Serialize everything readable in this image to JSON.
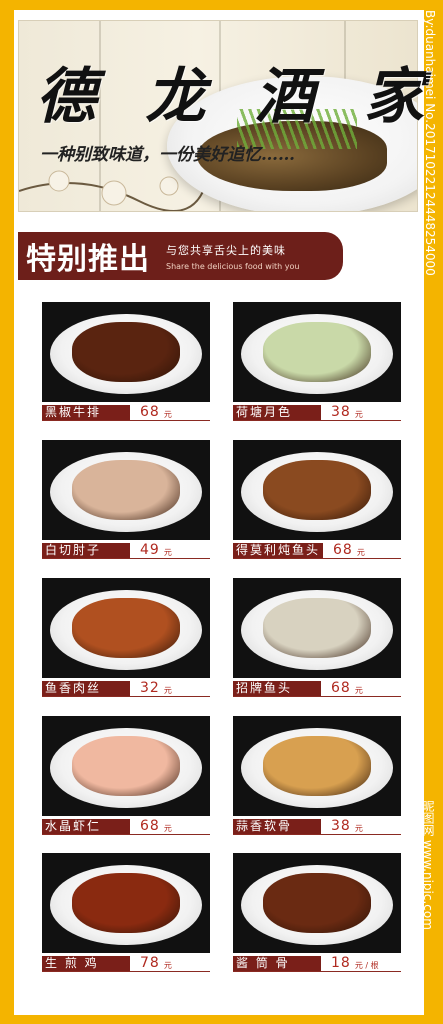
{
  "banner": {
    "title_chars": [
      "德",
      "龙",
      "酒",
      "家"
    ],
    "slogan": "一种别致味道，一份美好追忆……"
  },
  "section": {
    "title": "特别推出",
    "subtitle_cn": "与您共享舌尖上的美味",
    "subtitle_en": "Share the delicious food with you"
  },
  "dishes": [
    {
      "name": "黑椒牛排",
      "price": "68",
      "unit": "元",
      "food_color": "#5a2410"
    },
    {
      "name": "荷塘月色",
      "price": "38",
      "unit": "元",
      "food_color": "#c9d9a8"
    },
    {
      "name": "白切肘子",
      "price": "49",
      "unit": "元",
      "food_color": "#d9b49a"
    },
    {
      "name": "得莫利炖鱼头",
      "price": "68",
      "unit": "元",
      "food_color": "#8a4a20"
    },
    {
      "name": "鱼香肉丝",
      "price": "32",
      "unit": "元",
      "food_color": "#b05020"
    },
    {
      "name": "招牌鱼头",
      "price": "68",
      "unit": "元",
      "food_color": "#d8d2c0"
    },
    {
      "name": "水晶虾仁",
      "price": "68",
      "unit": "元",
      "food_color": "#f0b8a0"
    },
    {
      "name": "蒜香软骨",
      "price": "38",
      "unit": "元",
      "food_color": "#d8a050"
    },
    {
      "name": "生 煎 鸡",
      "price": "78",
      "unit": "元",
      "food_color": "#8a2a10"
    },
    {
      "name": "酱 筒 骨",
      "price": "18",
      "unit": "元 / 根",
      "food_color": "#6a2a12"
    }
  ],
  "watermarks": {
    "right_top": "By:duanhaimei No.20171022124448254000",
    "right_bottom": "昵图网 www.nipic.com"
  },
  "colors": {
    "frame": "#f4b400",
    "maroon": "#6d1f1a",
    "price_red": "#b02a20"
  }
}
